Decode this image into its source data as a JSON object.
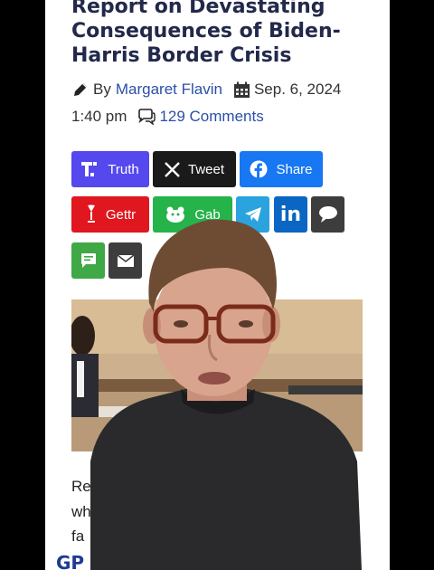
{
  "article": {
    "title_lines": [
      "Report on Devastating",
      "Consequences of Biden-",
      "Harris Border Crisis"
    ],
    "by_label": "By",
    "author": "Margaret Flavin",
    "date": "Sep. 6, 2024",
    "time": "1:40 pm",
    "comments": "129 Comments",
    "body_fragments": [
      "Re",
      "wh",
      "fa"
    ]
  },
  "share_buttons": [
    {
      "label": "Truth",
      "icon": "truth-social-icon",
      "color": "#5448ee"
    },
    {
      "label": "Tweet",
      "icon": "x-icon",
      "color": "#1a1a1a"
    },
    {
      "label": "Share",
      "icon": "facebook-icon",
      "color": "#1877f2"
    },
    {
      "label": "Gettr",
      "icon": "gettr-icon",
      "color": "#e0171f"
    },
    {
      "label": "Gab",
      "icon": "gab-icon",
      "color": "#25b34a"
    },
    {
      "label": "",
      "icon": "telegram-icon",
      "color": "#2aa3de"
    },
    {
      "label": "",
      "icon": "linkedin-icon",
      "color": "#0a66c2"
    },
    {
      "label": "",
      "icon": "comment-icon",
      "color": "#3d3d3d"
    },
    {
      "label": "",
      "icon": "sms-icon",
      "color": "#3fa847"
    },
    {
      "label": "",
      "icon": "email-icon",
      "color": "#3d3d3d"
    }
  ],
  "footer": {
    "logo_text": "GP"
  }
}
